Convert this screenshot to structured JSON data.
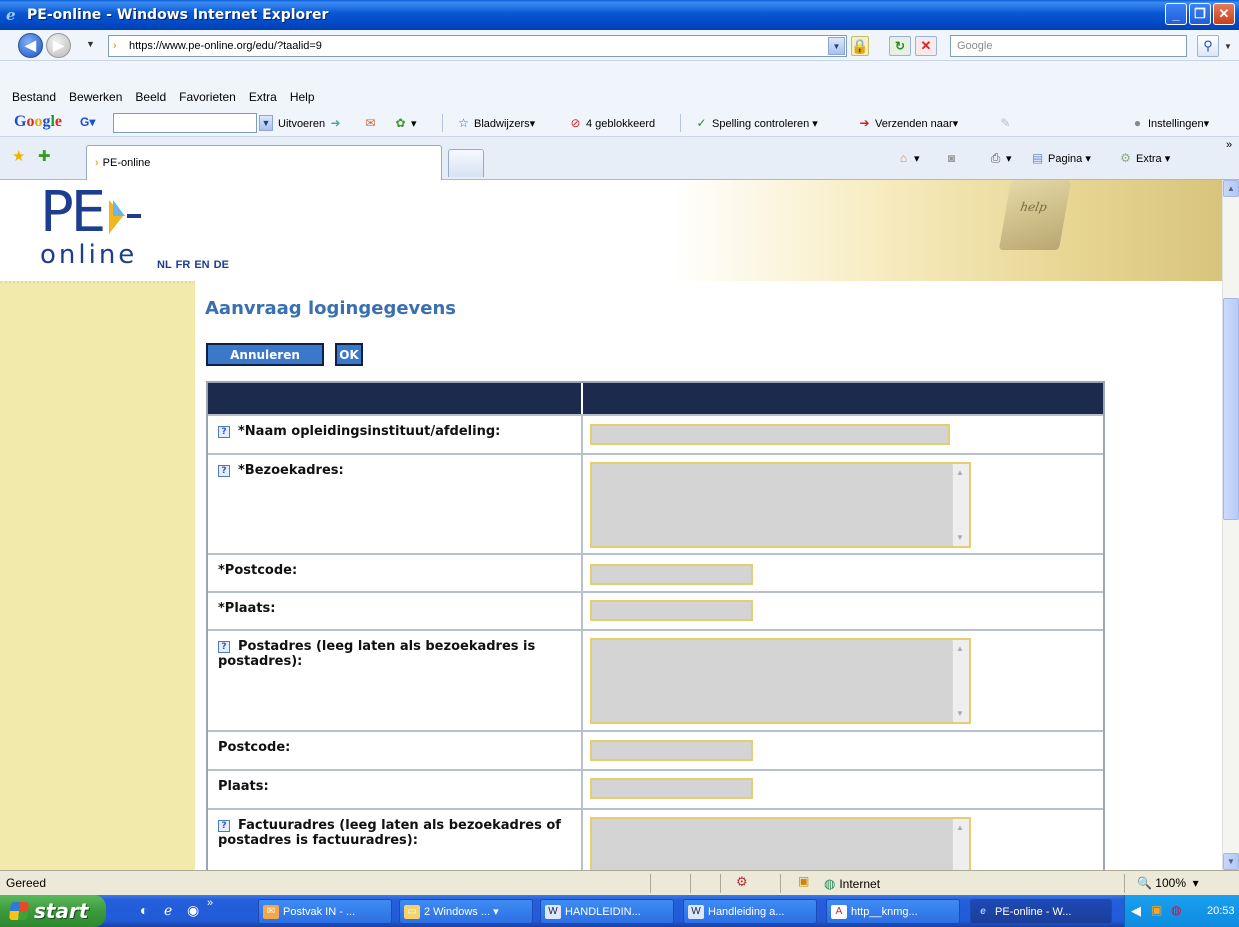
{
  "window": {
    "title": "PE-online - Windows Internet Explorer"
  },
  "address": {
    "url": "https://www.pe-online.org/edu/?taalid=9",
    "search_placeholder": "Google"
  },
  "menu": [
    "Bestand",
    "Bewerken",
    "Beeld",
    "Favorieten",
    "Extra",
    "Help"
  ],
  "google_toolbar": {
    "logo": "Google",
    "g_button": "G",
    "uitvoeren": "Uitvoeren",
    "bladwijzers": "Bladwijzers",
    "geblokkeerd": "4 geblokkeerd",
    "spelling": "Spelling controleren",
    "verzenden": "Verzenden naar",
    "instellingen": "Instellingen"
  },
  "tabs": {
    "active_label": "PE-online"
  },
  "commandbar": {
    "pagina": "Pagina",
    "extra": "Extra"
  },
  "page": {
    "logo_pe": "PE",
    "logo_online": "online",
    "languages": [
      "NL",
      "FR",
      "EN",
      "DE"
    ],
    "help_key": "help",
    "heading": "Aanvraag logingegevens",
    "cancel_label": "Annuleren",
    "ok_label": "OK",
    "fields": [
      {
        "label": "*Naam opleidingsinstituut/afdeling:",
        "help": true,
        "type": "input-wide"
      },
      {
        "label": "*Bezoekadres:",
        "help": true,
        "type": "textarea"
      },
      {
        "label": "*Postcode:",
        "help": false,
        "type": "input-short"
      },
      {
        "label": "*Plaats:",
        "help": false,
        "type": "input-short"
      },
      {
        "label": "Postadres (leeg laten als bezoekadres is postadres):",
        "help": true,
        "type": "textarea"
      },
      {
        "label": "Postcode:",
        "help": false,
        "type": "input-short"
      },
      {
        "label": "Plaats:",
        "help": false,
        "type": "input-short"
      },
      {
        "label": "Factuuradres (leeg laten als bezoekadres of postadres is factuuradres):",
        "help": true,
        "type": "textarea"
      }
    ]
  },
  "status": {
    "text": "Gereed",
    "zone": "Internet",
    "zoom": "100%"
  },
  "taskbar": {
    "start": "start",
    "tasks": [
      "Postvak IN - ...",
      "2 Windows ...",
      "HANDLEIDIN...",
      "Handleiding a...",
      "http__knmg...",
      "PE-online - W..."
    ],
    "clock": "20:53"
  },
  "colors": {
    "accent": "#3a78c9",
    "heading": "#3a6fb0",
    "sidebar": "#f2eaab",
    "table_header": "#1c2a4e",
    "input_border": "#e7cd72"
  }
}
